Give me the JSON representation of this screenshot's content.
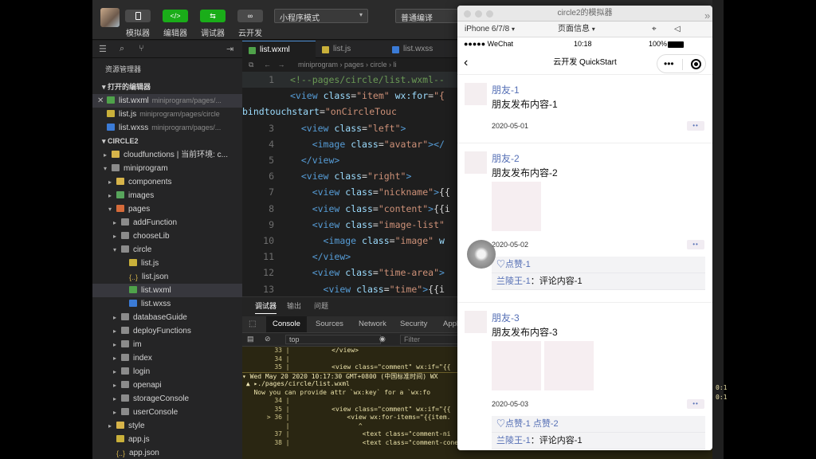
{
  "toolbar": {
    "simulator": "模拟器",
    "editor": "编辑器",
    "debugger": "调试器",
    "cloud": "云开发",
    "mode_select": "小程序模式",
    "compile_select": "普通编译",
    "editor_icon": "</>"
  },
  "explorer": {
    "title": "资源管理器",
    "open_editors": "打开的编辑器",
    "open_files": [
      {
        "name": "list.wxml",
        "path": "miniprogram/pages/...",
        "type": "wxml"
      },
      {
        "name": "list.js",
        "path": "miniprogram/pages/circle",
        "type": "js"
      },
      {
        "name": "list.wxss",
        "path": "miniprogram/pages/...",
        "type": "wxss"
      }
    ],
    "project": "CIRCLE2",
    "tree": [
      {
        "label": "cloudfunctions | 当前环境: c...",
        "depth": 1,
        "arrow": "▸",
        "icon": "ico-folder-y"
      },
      {
        "label": "miniprogram",
        "depth": 1,
        "arrow": "▾",
        "icon": "ico-folder"
      },
      {
        "label": "components",
        "depth": 2,
        "arrow": "▸",
        "icon": "ico-folder-y"
      },
      {
        "label": "images",
        "depth": 2,
        "arrow": "▸",
        "icon": "ico-folder-g"
      },
      {
        "label": "pages",
        "depth": 2,
        "arrow": "▾",
        "icon": "ico-folder-o"
      },
      {
        "label": "addFunction",
        "depth": 3,
        "arrow": "▸",
        "icon": "ico-folder"
      },
      {
        "label": "chooseLib",
        "depth": 3,
        "arrow": "▸",
        "icon": "ico-folder"
      },
      {
        "label": "circle",
        "depth": 3,
        "arrow": "▾",
        "icon": "ico-folder"
      },
      {
        "label": "list.js",
        "depth": 4,
        "arrow": "",
        "icon": "ico-js"
      },
      {
        "label": "list.json",
        "depth": 4,
        "arrow": "",
        "icon": "ico-json"
      },
      {
        "label": "list.wxml",
        "depth": 4,
        "arrow": "",
        "icon": "ico-wxml",
        "selected": true
      },
      {
        "label": "list.wxss",
        "depth": 4,
        "arrow": "",
        "icon": "ico-wxss"
      },
      {
        "label": "databaseGuide",
        "depth": 3,
        "arrow": "▸",
        "icon": "ico-folder"
      },
      {
        "label": "deployFunctions",
        "depth": 3,
        "arrow": "▸",
        "icon": "ico-folder"
      },
      {
        "label": "im",
        "depth": 3,
        "arrow": "▸",
        "icon": "ico-folder"
      },
      {
        "label": "index",
        "depth": 3,
        "arrow": "▸",
        "icon": "ico-folder"
      },
      {
        "label": "login",
        "depth": 3,
        "arrow": "▸",
        "icon": "ico-folder"
      },
      {
        "label": "openapi",
        "depth": 3,
        "arrow": "▸",
        "icon": "ico-folder"
      },
      {
        "label": "storageConsole",
        "depth": 3,
        "arrow": "▸",
        "icon": "ico-folder"
      },
      {
        "label": "userConsole",
        "depth": 3,
        "arrow": "▸",
        "icon": "ico-folder"
      },
      {
        "label": "style",
        "depth": 2,
        "arrow": "▸",
        "icon": "ico-folder-y"
      },
      {
        "label": "app.js",
        "depth": 2,
        "arrow": "",
        "icon": "ico-js"
      },
      {
        "label": "app.json",
        "depth": 2,
        "arrow": "",
        "icon": "ico-json"
      }
    ]
  },
  "editor": {
    "tabs": [
      {
        "name": "list.wxml",
        "type": "wxml",
        "active": true
      },
      {
        "name": "list.js",
        "type": "js"
      },
      {
        "name": "list.wxss",
        "type": "wxss"
      }
    ],
    "breadcrumb": "miniprogram  ›  pages  ›  circle  ›  li",
    "lines": [
      {
        "n": "1",
        "html": "<span class='c-com'>&lt;!--pages/circle/list.wxml--</span>",
        "hl": true
      },
      {
        "n": "",
        "html": "<span class='c-tag'>&lt;view</span> <span class='c-attr'>class</span><span class='c-txt'>=</span><span class='c-str'>\"item\"</span> <span class='c-attr'>wx:for</span><span class='c-txt'>=</span><span class='c-str'>\"{</span>"
      },
      {
        "n": "",
        "html": "<span class='c-attr'>bindtouchstart</span><span class='c-txt'>=</span><span class='c-str'>\"onCircleTouc</span>",
        "raw": true
      },
      {
        "n": "3",
        "html": "  <span class='c-tag'>&lt;view</span> <span class='c-attr'>class</span><span class='c-txt'>=</span><span class='c-str'>\"left\"</span><span class='c-tag'>&gt;</span>"
      },
      {
        "n": "4",
        "html": "    <span class='c-tag'>&lt;image</span> <span class='c-attr'>class</span><span class='c-txt'>=</span><span class='c-str'>\"avatar\"</span><span class='c-tag'>&gt;&lt;/</span>"
      },
      {
        "n": "5",
        "html": "  <span class='c-tag'>&lt;/view&gt;</span>"
      },
      {
        "n": "6",
        "html": "  <span class='c-tag'>&lt;view</span> <span class='c-attr'>class</span><span class='c-txt'>=</span><span class='c-str'>\"right\"</span><span class='c-tag'>&gt;</span>"
      },
      {
        "n": "7",
        "html": "    <span class='c-tag'>&lt;view</span> <span class='c-attr'>class</span><span class='c-txt'>=</span><span class='c-str'>\"nickname\"</span><span class='c-tag'>&gt;</span><span class='c-txt'>{{</span>"
      },
      {
        "n": "8",
        "html": "    <span class='c-tag'>&lt;view</span> <span class='c-attr'>class</span><span class='c-txt'>=</span><span class='c-str'>\"content\"</span><span class='c-tag'>&gt;</span><span class='c-txt'>{{i</span>"
      },
      {
        "n": "9",
        "html": "    <span class='c-tag'>&lt;view</span> <span class='c-attr'>class</span><span class='c-txt'>=</span><span class='c-str'>\"image-list\"</span>"
      },
      {
        "n": "10",
        "html": "      <span class='c-tag'>&lt;image</span> <span class='c-attr'>class</span><span class='c-txt'>=</span><span class='c-str'>\"image\"</span> <span class='c-attr'>w</span>"
      },
      {
        "n": "11",
        "html": "    <span class='c-tag'>&lt;/view&gt;</span>"
      },
      {
        "n": "12",
        "html": "    <span class='c-tag'>&lt;view</span> <span class='c-attr'>class</span><span class='c-txt'>=</span><span class='c-str'>\"time-area\"</span><span class='c-tag'>&gt;</span>"
      },
      {
        "n": "13",
        "html": "      <span class='c-tag'>&lt;view</span> <span class='c-attr'>class</span><span class='c-txt'>=</span><span class='c-str'>\"time\"</span><span class='c-tag'>&gt;</span><span class='c-txt'>{{i</span>"
      }
    ]
  },
  "panel": {
    "tabs": [
      "调试器",
      "输出",
      "问题"
    ],
    "devtools_tabs": [
      "Console",
      "Sources",
      "Network",
      "Security",
      "Appl"
    ],
    "context": "top",
    "filter_placeholder": "Filter",
    "console_lines": [
      {
        "num": "33",
        "bar": "|",
        "text": "          </view>"
      },
      {
        "num": "34",
        "bar": "|",
        "text": ""
      },
      {
        "num": "35",
        "bar": "|",
        "text": "          <view class=\"comment\" wx:if=\"{{"
      },
      {
        "num": "",
        "bar": "",
        "text": "▾ Wed May 20 2020 10:17:30 GMT+0800 (中国标准时间) WX",
        "hdr": true,
        "sep": true
      },
      {
        "num": "",
        "bar": "",
        "text": " ▲ ▸./pages/circle/list.wxml",
        "hdr": true
      },
      {
        "num": "",
        "bar": "",
        "text": "   Now you can provide attr `wx:key` for a `wx:fo"
      },
      {
        "num": "34",
        "bar": "|",
        "text": ""
      },
      {
        "num": "35",
        "bar": "|",
        "text": "          <view class=\"comment\" wx:if=\"{{"
      },
      {
        "num": "> 36",
        "bar": "|",
        "text": "              <view wx:for-items=\"{{item."
      },
      {
        "num": "",
        "bar": "|",
        "text": "                 ^"
      },
      {
        "num": "37",
        "bar": "|",
        "text": "                  <text class=\"comment-ni"
      },
      {
        "num": "38",
        "bar": "|",
        "text": "                  <text class=\"comment-conetnt\">{{comment.content}}</text>"
      }
    ],
    "side_refs": [
      "0:1",
      "0:1"
    ]
  },
  "simulator": {
    "window_title": "circle2的模拟器",
    "device": "iPhone 6/7/8",
    "page_info": "页面信息",
    "carrier": "●●●●● WeChat",
    "time": "10:18",
    "battery": "100%",
    "nav_title": "云开发 QuickStart",
    "posts": [
      {
        "nick": "朋友-1",
        "content": "朋友发布内容-1",
        "time": "2020-05-01",
        "images": 0,
        "likes": "",
        "comments": []
      },
      {
        "nick": "朋友-2",
        "content": "朋友发布内容-2",
        "time": "2020-05-02",
        "images": 1,
        "likes": "♡点赞-1",
        "comments": [
          {
            "who": "兰陵王-1",
            "text": "评论内容-1"
          }
        ]
      },
      {
        "nick": "朋友-3",
        "content": "朋友发布内容-3",
        "time": "2020-05-03",
        "images": 2,
        "likes": "♡点赞-1 点赞-2",
        "comments": [
          {
            "who": "兰陵王-1",
            "text": "评论内容-1"
          }
        ]
      }
    ]
  }
}
